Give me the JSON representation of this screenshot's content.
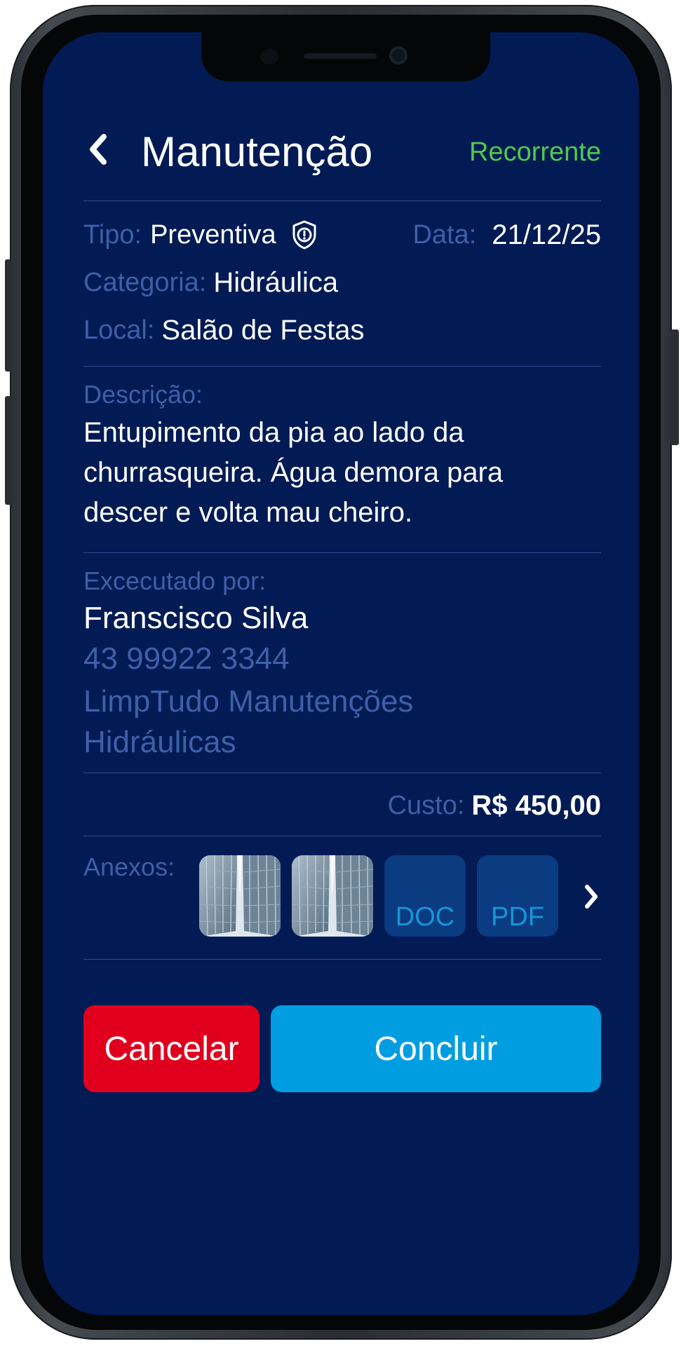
{
  "header": {
    "title": "Manutenção",
    "status": "Recorrente"
  },
  "details": {
    "type_label": "Tipo:",
    "type_value": "Preventiva",
    "date_label": "Data:",
    "date_value": "21/12/25",
    "category_label": "Categoria:",
    "category_value": "Hidráulica",
    "location_label": "Local:",
    "location_value": "Salão de Festas"
  },
  "description": {
    "label": "Descrição:",
    "text": "Entupimento da pia ao lado da churrasqueira. Água demora para descer e volta mau cheiro."
  },
  "executor": {
    "label": "Excecutado por:",
    "name": "Franscisco Silva",
    "phone": "43 99922 3344",
    "company": "LimpTudo Manutenções Hidráulicas"
  },
  "cost": {
    "label": "Custo:",
    "value": "R$ 450,00"
  },
  "attachments": {
    "label": "Anexos:",
    "items": [
      {
        "kind": "image",
        "icon": "building-photo"
      },
      {
        "kind": "image",
        "icon": "building-photo"
      },
      {
        "kind": "file",
        "text": "DOC"
      },
      {
        "kind": "file",
        "text": "PDF"
      }
    ],
    "more_icon": "chevron-right-icon"
  },
  "actions": {
    "cancel": "Cancelar",
    "confirm": "Concluir"
  },
  "colors": {
    "background": "#021b55",
    "label": "#3f5fa6",
    "status_green": "#52c84e",
    "cancel_red": "#e0001e",
    "confirm_blue": "#009ee0",
    "file_tile": "#0b3b80"
  }
}
